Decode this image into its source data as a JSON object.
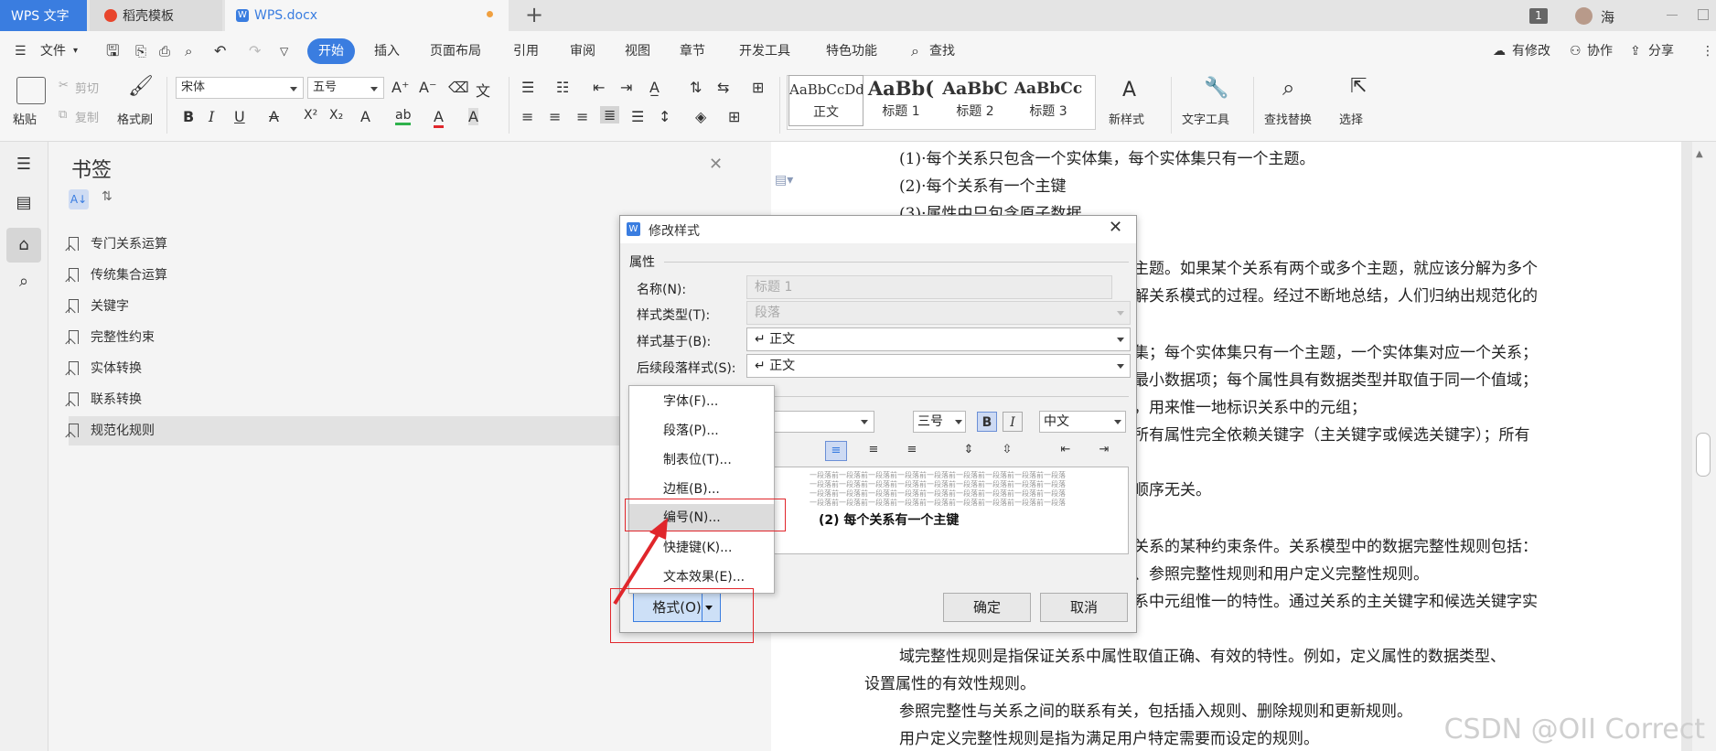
{
  "tabs": {
    "app": "WPS 文字",
    "template": "稻壳模板",
    "doc": "WPS.docx",
    "new_tab": "+",
    "badge": "1",
    "user": "海"
  },
  "menu": {
    "file": "文件",
    "items": [
      "开始",
      "插入",
      "页面布局",
      "引用",
      "审阅",
      "视图",
      "章节",
      "开发工具",
      "特色功能"
    ],
    "search": "查找",
    "right": [
      "有修改",
      "协作",
      "分享"
    ]
  },
  "ribbon": {
    "paste": "粘贴",
    "cut": "剪切",
    "copy": "复制",
    "format_painter": "格式刷",
    "font": "宋体",
    "size": "五号",
    "styles": [
      {
        "preview": "AaBbCcDd",
        "name": "正文"
      },
      {
        "preview": "AaBb(",
        "name": "标题 1"
      },
      {
        "preview": "AaBbC",
        "name": "标题 2"
      },
      {
        "preview": "AaBbCc",
        "name": "标题 3"
      }
    ],
    "new_style": "新样式",
    "text_tools": "文字工具",
    "find_replace": "查找替换",
    "select": "选择"
  },
  "bookmarks": {
    "title": "书签",
    "items": [
      "专门关系运算",
      "传统集合运算",
      "关键字",
      "完整性约束",
      "实体转换",
      "联系转换",
      "规范化规则"
    ]
  },
  "doc_lines": [
    "(1)·每个关系只包含一个实体集，每个实体集只有一个主题。",
    "(2)·每个关系有一个主键",
    "(3)·属性中只包含原子数据",
    "主题。如果某个关系有两个或多个主题，就应该分解为多个",
    "解关系模式的过程。经过不断地总结，人们归纳出规范化的",
    "集；每个实体集只有一个主题，一个实体集对应一个关系；",
    "最小数据项；每个属性具有数据类型并取值于同一个值域；",
    "，用来惟一地标识关系中的元组；",
    "所有属性完全依赖关键字（主关键字或候选关键字）；所有",
    "顺序无关。",
    "关系的某种约束条件。关系模型中的数据完整性规则包括：",
    "、参照完整性规则和用户定义完整性规则。",
    "系中元组惟一的特性。通过关系的主关键字和候选关键字实",
    "域完整性规则是指保证关系中属性取值正确、有效的特性。例如，定义属性的数据类型、",
    "设置属性的有效性规则。",
    "参照完整性与关系之间的联系有关，包括插入规则、删除规则和更新规则。",
    "用户定义完整性规则是指为满足用户特定需要而设定的规则。"
  ],
  "dialog": {
    "title": "修改样式",
    "section": "属性",
    "name_label": "名称(N):",
    "name_value": "标题 1",
    "type_label": "样式类型(T):",
    "type_value": "段落",
    "based_label": "样式基于(B):",
    "based_value": "↵ 正文",
    "next_label": "后续段落样式(S):",
    "next_value": "↵ 正文",
    "font_size": "三号",
    "lang": "中文",
    "bold": "B",
    "italic": "I",
    "preview_prev": "一段落前一段落前一段落前一段落前一段落前一段落前一段落前一段落前一段落",
    "preview_text": "(2)  每个关系有一个主键",
    "format_button": "格式(O)",
    "ok": "确定",
    "cancel": "取消"
  },
  "format_menu": [
    "字体(F)...",
    "段落(P)...",
    "制表位(T)...",
    "边框(B)...",
    "编号(N)...",
    "快捷键(K)...",
    "文本效果(E)..."
  ],
  "watermark": "CSDN @OII Correct",
  "colors": {
    "accent": "#3a7de0",
    "highlight_red": "#e0262b"
  }
}
